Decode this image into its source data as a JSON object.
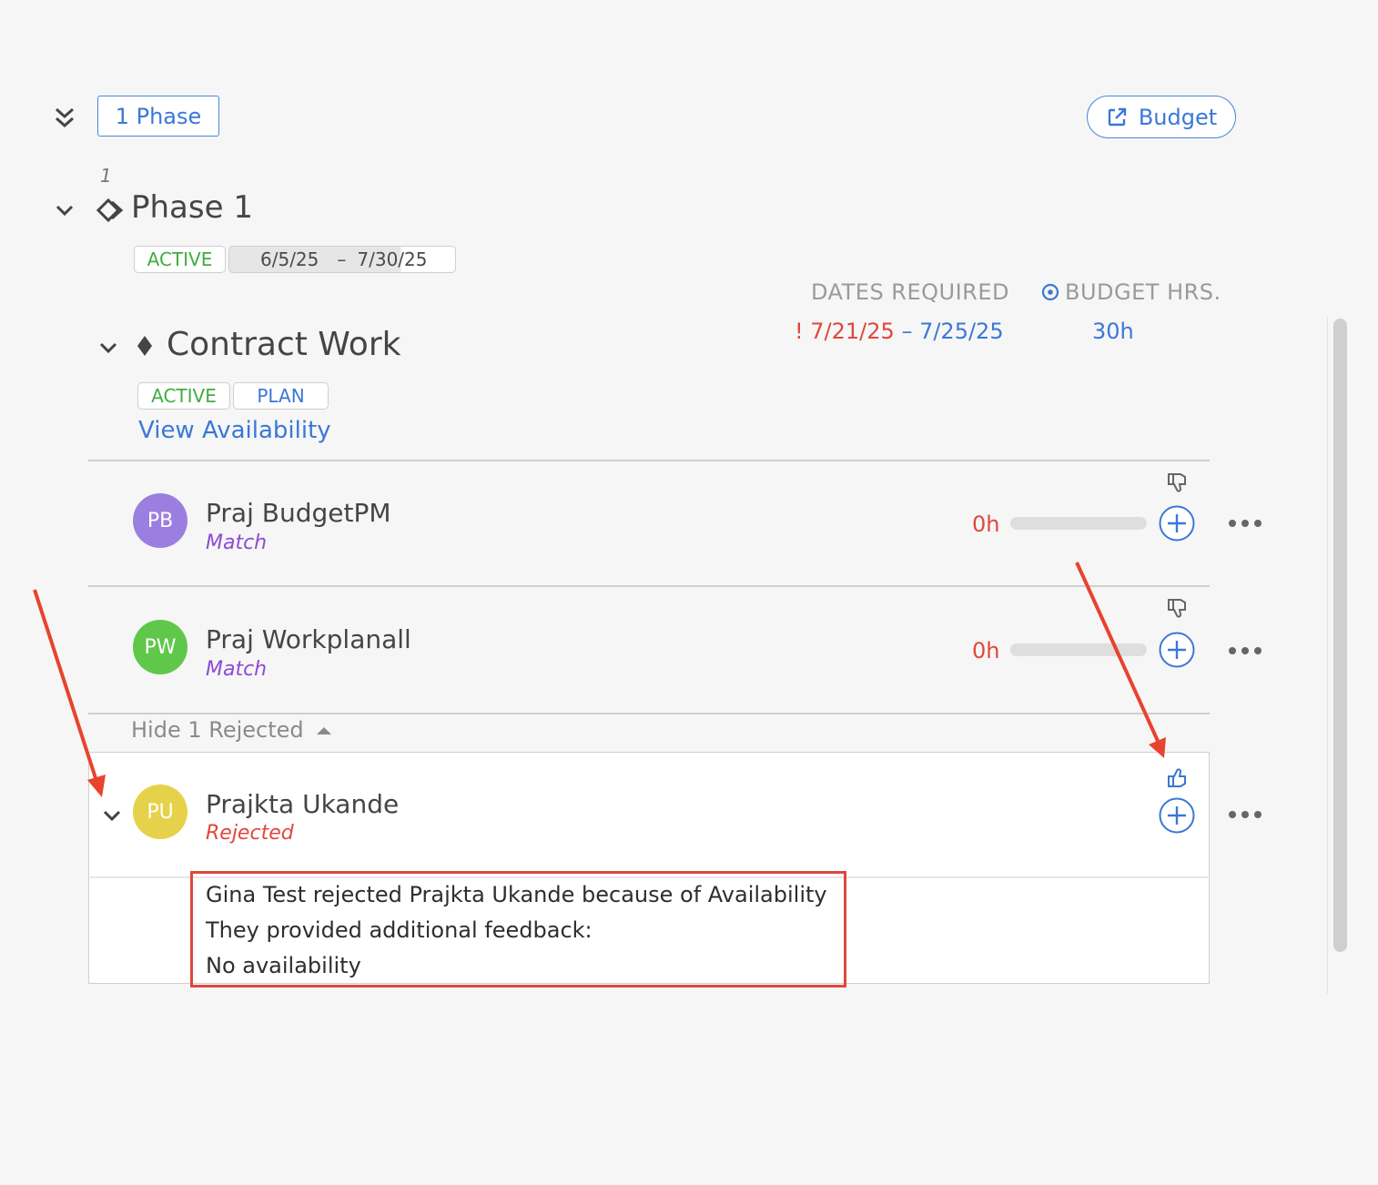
{
  "toolbar": {
    "phase_count_label": "1 Phase",
    "budget_label": "Budget"
  },
  "phase": {
    "number": "1",
    "title": "Phase 1",
    "status": "ACTIVE",
    "start_date": "6/5/25",
    "date_separator": "–",
    "end_date": "7/30/25"
  },
  "columns": {
    "dates_required": "DATES REQUIRED",
    "budget_hrs": "BUDGET HRS."
  },
  "work_item": {
    "title": "Contract Work",
    "status": "ACTIVE",
    "type": "PLAN",
    "view_availability": "View Availability",
    "required_warning": "!",
    "required_start": "7/21/25",
    "required_separator": "–",
    "required_end": "7/25/25",
    "budget_hours": "30h"
  },
  "candidates": [
    {
      "initials": "PB",
      "name": "Praj BudgetPM",
      "status": "Match",
      "hours": "0h",
      "avatar_color": "#9b7fe0"
    },
    {
      "initials": "PW",
      "name": "Praj Workplanall",
      "status": "Match",
      "hours": "0h",
      "avatar_color": "#5fc84a"
    }
  ],
  "rejected_toggle": {
    "label": "Hide 1 Rejected"
  },
  "rejected": {
    "initials": "PU",
    "name": "Prajkta Ukande",
    "status": "Rejected",
    "avatar_color": "#e6d24a",
    "feedback": [
      "Gina Test rejected Prajkta Ukande because of Availability",
      "They provided additional feedback:",
      "No availability"
    ]
  },
  "colors": {
    "accent": "#3a78d6",
    "active_green": "#3fae3f",
    "match_purple": "#8e4ad6",
    "rejected_red": "#e0473c",
    "annotation_red": "#e8432f"
  },
  "icons": [
    "collapse-all-icon",
    "external-link-icon",
    "chevron-down-icon",
    "phase-diamond-icon",
    "milestone-diamond-icon",
    "thumbs-down-icon",
    "thumbs-up-icon",
    "plus-circle-icon",
    "more-horizontal-icon",
    "caret-up-icon",
    "target-icon"
  ]
}
